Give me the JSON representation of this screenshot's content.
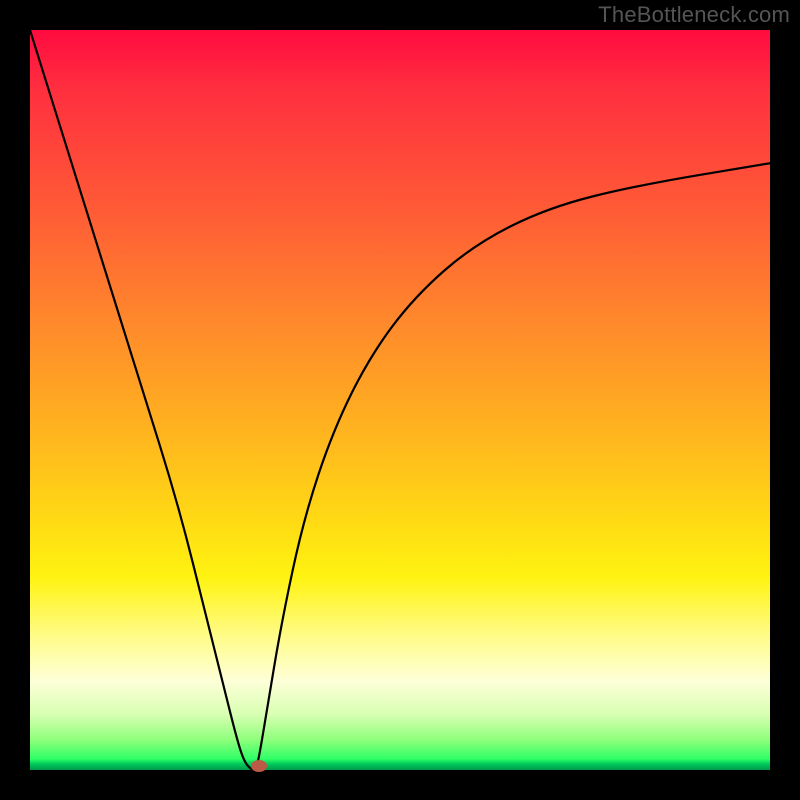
{
  "watermark": "TheBottleneck.com",
  "chart_data": {
    "type": "line",
    "title": "",
    "xlabel": "",
    "ylabel": "",
    "xlim": [
      0,
      100
    ],
    "ylim": [
      0,
      100
    ],
    "grid": false,
    "legend": false,
    "series": [
      {
        "name": "curve",
        "x": [
          0,
          5,
          10,
          15,
          20,
          24,
          26,
          28,
          29,
          30,
          30.5,
          31,
          32,
          34,
          37,
          41,
          46,
          52,
          60,
          70,
          82,
          100
        ],
        "y": [
          100,
          84,
          68,
          52,
          36,
          20,
          12,
          4,
          1,
          0,
          0,
          2,
          8,
          20,
          34,
          46,
          56,
          64,
          71,
          76,
          79,
          82
        ]
      }
    ],
    "marker": {
      "x": 31,
      "y": 0.5,
      "color": "#bb5a47"
    },
    "gradient_stops": [
      {
        "pos": 0,
        "color": "#ff0b3f"
      },
      {
        "pos": 40,
        "color": "#ff8a2b"
      },
      {
        "pos": 66,
        "color": "#ffd914"
      },
      {
        "pos": 88,
        "color": "#fdffd8"
      },
      {
        "pos": 100,
        "color": "#009a4a"
      }
    ]
  }
}
